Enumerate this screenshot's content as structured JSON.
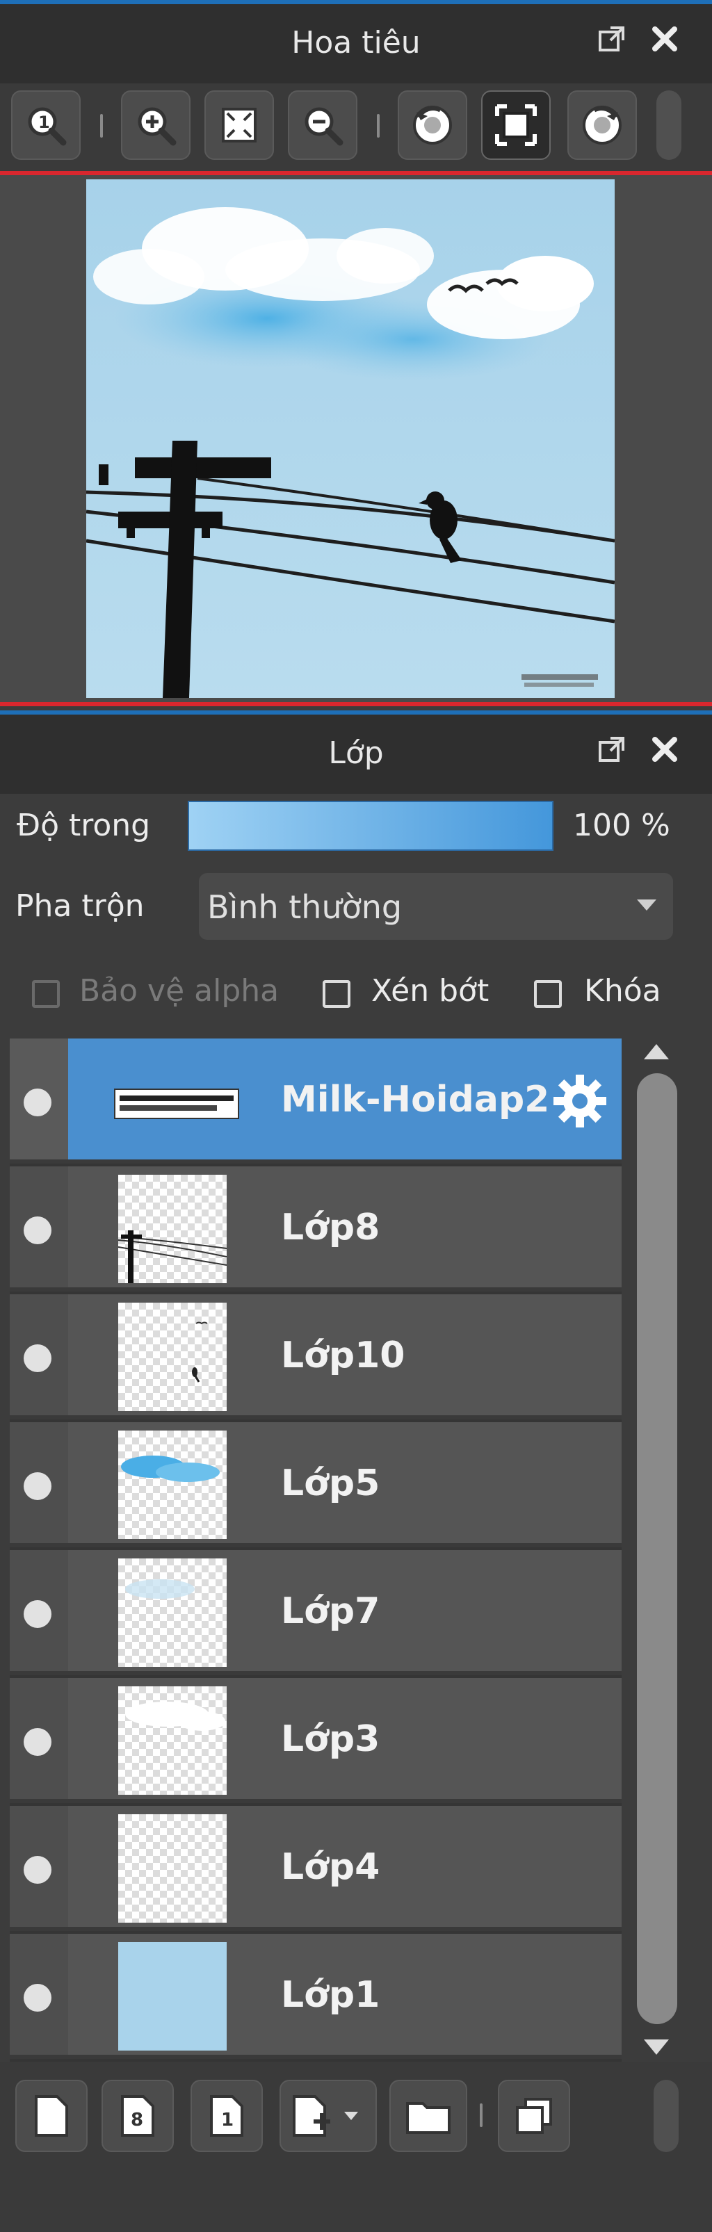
{
  "navigator": {
    "title": "Hoa tiêu",
    "toolbar_icons": [
      "zoom-actual-icon",
      "zoom-in-icon",
      "fit-screen-icon",
      "zoom-out-icon",
      "rotate-left-icon",
      "fullscreen-icon",
      "rotate-right-icon"
    ]
  },
  "layers_panel": {
    "title": "Lớp",
    "opacity_label": "Độ trong",
    "opacity_value": "100 %",
    "blend_label": "Pha trộn",
    "blend_value": "Bình thường",
    "protect_alpha_label": "Bảo vệ alpha",
    "clipping_label": "Xén bớt",
    "lock_label": "Khóa",
    "layers": [
      {
        "name": "Milk-Hoidap2",
        "selected": true
      },
      {
        "name": "Lớp8"
      },
      {
        "name": "Lớp10"
      },
      {
        "name": "Lớp5"
      },
      {
        "name": "Lớp7"
      },
      {
        "name": "Lớp3"
      },
      {
        "name": "Lớp4"
      },
      {
        "name": "Lớp1"
      }
    ]
  },
  "colors": {
    "accent_blue": "#4a8fcf",
    "red_frame": "#d9272e",
    "sky": "#a9d3eb"
  }
}
